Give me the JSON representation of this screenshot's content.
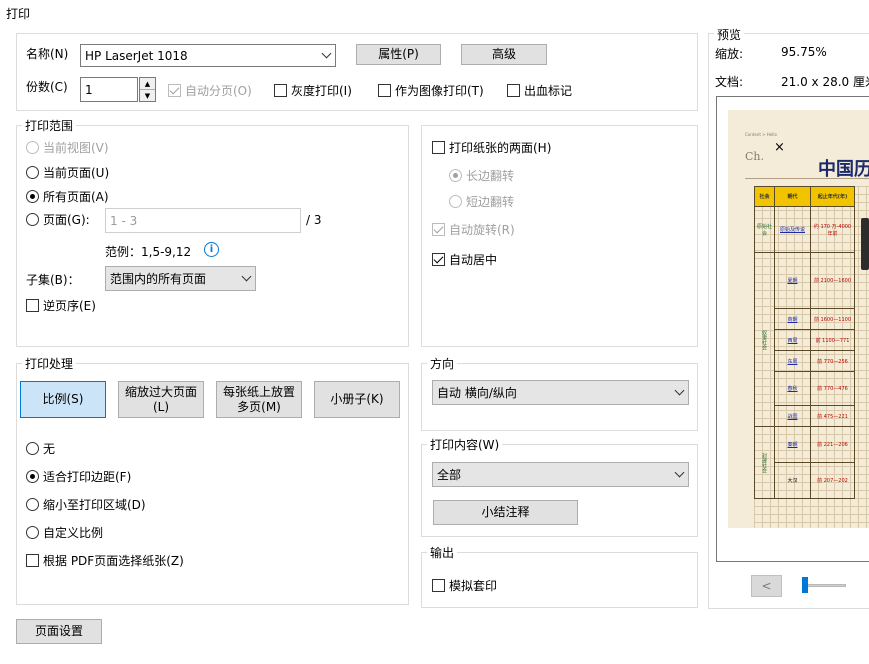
{
  "dialog": {
    "title": "打印"
  },
  "printer": {
    "name_label": "名称(N)",
    "name_value": "HP LaserJet 1018",
    "properties_button": "属性(P)",
    "advanced_button": "高级",
    "copies_label": "份数(C)",
    "copies_value": "1",
    "collate_label": "自动分页(O)",
    "grayscale_label": "灰度打印(I)",
    "as_image_label": "作为图像打印(T)",
    "bleed_marks_label": "出血标记"
  },
  "range": {
    "title": "打印范围",
    "current_view": "当前视图(V)",
    "current_page": "当前页面(U)",
    "all_pages": "所有页面(A)",
    "pages": "页面(G):",
    "pages_placeholder": "1 - 3",
    "pages_total": "/ 3",
    "example": "范例：1,5-9,12",
    "subset_label": "子集(B)：",
    "subset_value": "范围内的所有页面",
    "reverse_label": "逆页序(E)"
  },
  "duplex": {
    "both_sides_label": "打印纸张的两面(H)",
    "long_edge": "长边翻转",
    "short_edge": "短边翻转",
    "auto_rotate": "自动旋转(R)",
    "auto_center": "自动居中"
  },
  "handling": {
    "title": "打印处理",
    "scale_button": "比例(S)",
    "poster_button": "缩放过大页面(L)",
    "multiple_button": "每张纸上放置多页(M)",
    "booklet_button": "小册子(K)",
    "none": "无",
    "fit_margins": "适合打印边距(F)",
    "shrink": "缩小至打印区域(D)",
    "custom_scale": "自定义比例",
    "choose_paper": "根据 PDF页面选择纸张(Z)"
  },
  "orientation": {
    "title": "方向",
    "value": "自动 横向/纵向"
  },
  "content": {
    "title": "打印内容(W)",
    "value": "全部",
    "summarize_button": "小结注释"
  },
  "output": {
    "title": "输出",
    "simulate_overprint": "模拟套印"
  },
  "page_setup_button": "页面设置",
  "preview": {
    "title": "预览",
    "zoom_label": "缩放:",
    "zoom_value": "95.75%",
    "doc_label": "文档:",
    "doc_value": "21.0 x 28.0 厘米",
    "prev_button": "<",
    "sheet": {
      "breadcrumb": "Content > Hello",
      "close_mark": "×",
      "ch_mark": "Ch.",
      "heading": "中国历",
      "head": [
        "社会",
        "朝代",
        "起止年代(年)"
      ],
      "era_primitive": "原始社会",
      "era_slave": "奴隶社会",
      "era_feudal": "封建社会",
      "rows": [
        [
          "",
          "原始及传说",
          "约 170 万-4000年前"
        ],
        [
          "",
          "夏朝",
          "前 2100—1600"
        ],
        [
          "",
          "商朝",
          "前 1600—1100"
        ],
        [
          "",
          "西周",
          "前 1100—771"
        ],
        [
          "",
          "东周",
          "前 770—256"
        ],
        [
          "",
          "春秋",
          "前 770—476"
        ],
        [
          "",
          "战国",
          "前 475—221"
        ],
        [
          "",
          "秦朝",
          "前 221—206"
        ],
        [
          "",
          "大汉",
          "前 207—202"
        ]
      ]
    }
  },
  "colors": {
    "accent": "#0078d7",
    "selected_bg": "#cce4f7",
    "header_yellow": "#f2c400"
  }
}
